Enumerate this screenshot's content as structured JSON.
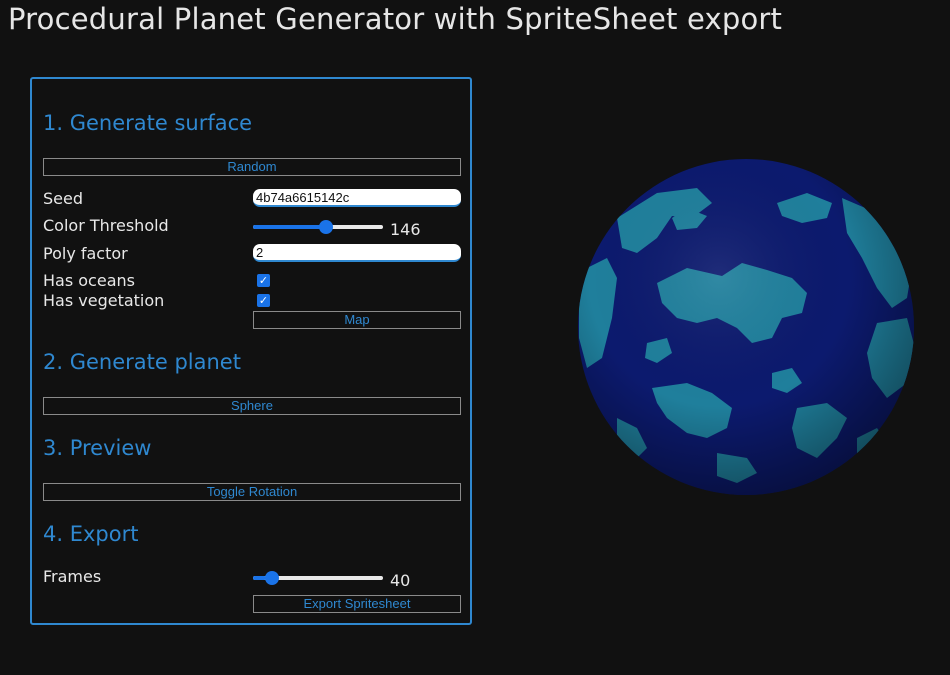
{
  "page": {
    "title": "Procedural Planet Generator with SpriteSheet export"
  },
  "surface": {
    "heading": "1. Generate surface",
    "random_label": "Random",
    "seed_label": "Seed",
    "seed_value": "4b74a6615142c",
    "threshold_label": "Color Threshold",
    "threshold_value": "146",
    "threshold_fraction": 0.57,
    "poly_label": "Poly factor",
    "poly_value": "2",
    "oceans_label": "Has oceans",
    "oceans_checked": true,
    "vegetation_label": "Has vegetation",
    "vegetation_checked": true,
    "map_label": "Map"
  },
  "planet": {
    "heading": "2. Generate planet",
    "sphere_label": "Sphere"
  },
  "preview": {
    "heading": "3. Preview",
    "toggle_label": "Toggle Rotation"
  },
  "export": {
    "heading": "4. Export",
    "frames_label": "Frames",
    "frames_value": "40",
    "frames_fraction": 0.1,
    "export_label": "Export Spritesheet"
  },
  "colors": {
    "accent": "#2f88d0",
    "slider": "#1a73e8",
    "background": "#111111",
    "planet_ocean": "#0c1a6e",
    "planet_land": "#1f7f9c"
  },
  "icons": {
    "checkbox": "checkmark-icon"
  }
}
